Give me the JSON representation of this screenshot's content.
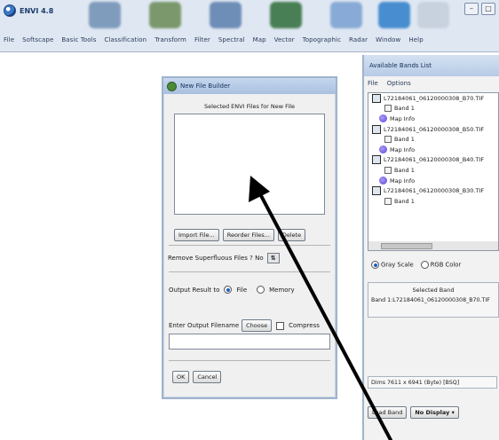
{
  "envi": {
    "title": "ENVI 4.8",
    "menus": [
      "File",
      "Softscape",
      "Basic Tools",
      "Classification",
      "Transform",
      "Filter",
      "Spectral",
      "Map",
      "Vector",
      "Topographic",
      "Radar",
      "Window",
      "Help"
    ]
  },
  "new_file_builder": {
    "title": "New File Builder",
    "list_header": "Selected ENVI Files for New File",
    "buttons": {
      "import": "Import File...",
      "reorder": "Reorder Files...",
      "delete": "Delete"
    },
    "remove_superfluous": "Remove Superfluous Files ? No",
    "toggle_symbol": "⇅",
    "output_result_to": "Output Result to",
    "output_file": "File",
    "output_memory": "Memory",
    "enter_filename": "Enter Output Filename",
    "choose": "Choose",
    "compress": "Compress",
    "ok": "OK",
    "cancel": "Cancel"
  },
  "available_bands": {
    "title": "Available Bands List",
    "menu": [
      "File",
      "Options"
    ],
    "tree": [
      {
        "kind": "file",
        "label": "L72184061_06120000308_B70.TIF"
      },
      {
        "kind": "band",
        "label": "Band 1"
      },
      {
        "kind": "map",
        "label": "Map Info"
      },
      {
        "kind": "file",
        "label": "L72184061_06120000308_B50.TIF"
      },
      {
        "kind": "band",
        "label": "Band 1"
      },
      {
        "kind": "map",
        "label": "Map Info"
      },
      {
        "kind": "file",
        "label": "L72184061_06120000308_B40.TIF"
      },
      {
        "kind": "band",
        "label": "Band 1"
      },
      {
        "kind": "map",
        "label": "Map Info"
      },
      {
        "kind": "file",
        "label": "L72184061_06120000308_B30.TIF"
      },
      {
        "kind": "band",
        "label": "Band 1"
      }
    ],
    "gray_scale": "Gray Scale",
    "rgb_color": "RGB Color",
    "selected_band_label": "Selected Band",
    "selected_band_value": "Band 1:L72184061_06120000308_B70.TIF",
    "dims": "Dims 7611 x 6941 (Byte) [BSQ]",
    "load_band": "Load Band",
    "no_display": "No Display"
  }
}
